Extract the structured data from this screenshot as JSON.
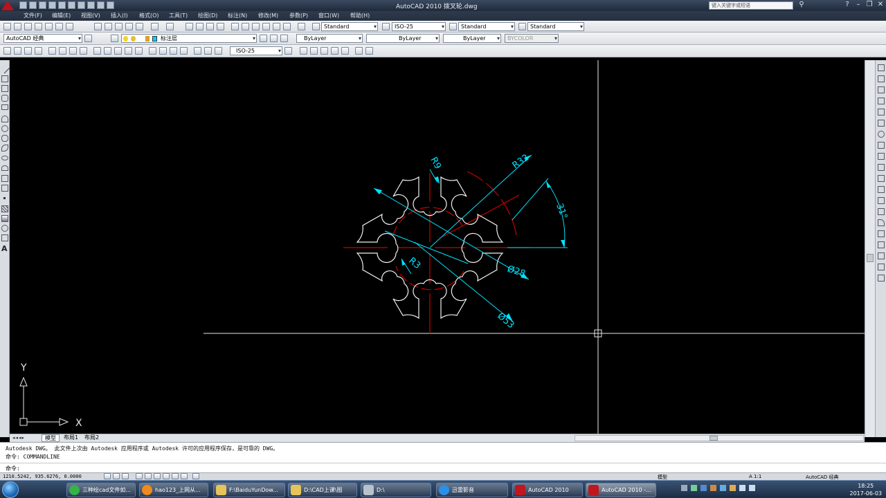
{
  "app": {
    "title": "AutoCAD 2010    拨叉轮.dwg",
    "search_placeholder": "键入关键字或短语"
  },
  "menu": [
    "文件(F)",
    "编辑(E)",
    "视图(V)",
    "插入(I)",
    "格式(O)",
    "工具(T)",
    "绘图(D)",
    "标注(N)",
    "修改(M)",
    "参数(P)",
    "窗口(W)",
    "帮助(H)"
  ],
  "toolbar": {
    "text_style": "Standard",
    "dim_style": "ISO-25",
    "table_style": "Standard",
    "multileader_style": "Standard",
    "workspace": "AutoCAD 经典",
    "layer": "标注层",
    "color": "ByLayer",
    "linetype": "ByLayer",
    "lineweight": "ByLayer",
    "plotstyle": "BYCOLOR",
    "dim_style2": "ISO-25"
  },
  "drawing": {
    "dims": {
      "r9": "R9",
      "r32": "R32",
      "angle": "31°",
      "r3": "R3",
      "d28": "Ø28",
      "d53": "Ø53"
    },
    "ucs_x": "X",
    "ucs_y": "Y"
  },
  "layout_tabs": [
    "模型",
    "布局1",
    "布局2"
  ],
  "command": {
    "line1": "Autodesk DWG。  此文件上次由 Autodesk 应用程序或 Autodesk 许可的应用程序保存，是可靠的 DWG。",
    "line2": "命令: COMMANDLINE",
    "prompt": "命令:"
  },
  "status": {
    "coords": "1210.5242, 935.6276, 0.0000",
    "model": "模型",
    "scale": "A 1:1",
    "workspace": "AutoCAD 经典"
  },
  "taskbar": {
    "items": [
      "三种绘cad文件如...",
      "hao123_上网从...",
      "F:\\BaiduYunDow...",
      "D:\\CAD上课\\图",
      "D:\\",
      "迅雷影音",
      "AutoCAD 2010",
      "AutoCAD 2010 -..."
    ],
    "time": "18:25",
    "date": "2017-06-03"
  },
  "colors": {
    "canvas": "#000000",
    "geometry": "#ffffff",
    "dimension": "#00e5ff",
    "centerline": "#cc0000"
  }
}
